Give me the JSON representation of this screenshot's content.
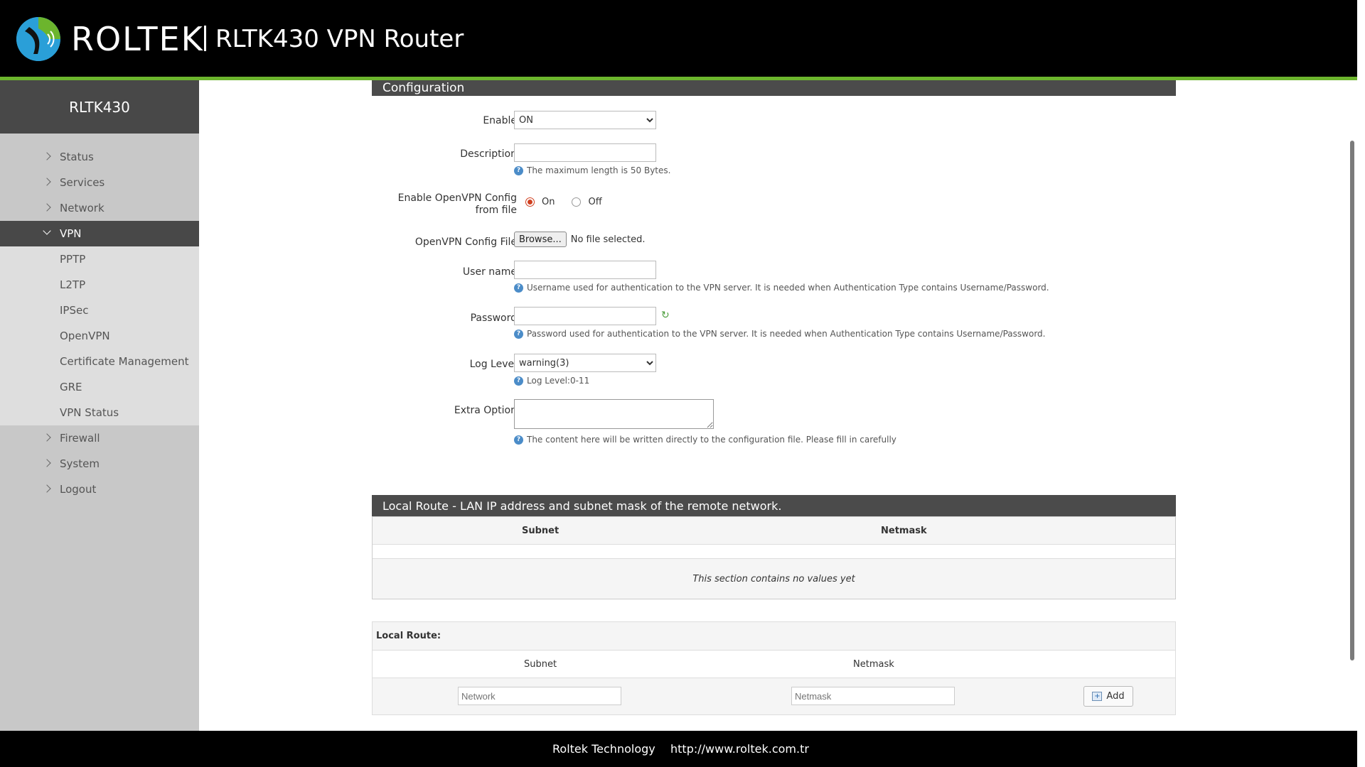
{
  "header": {
    "brand": "ROLTEK",
    "product": "RLTK430 VPN Router"
  },
  "sidebar": {
    "title": "RLTK430",
    "items": [
      {
        "label": "Status"
      },
      {
        "label": "Services"
      },
      {
        "label": "Network"
      },
      {
        "label": "VPN"
      },
      {
        "label": "Firewall"
      },
      {
        "label": "System"
      },
      {
        "label": "Logout"
      }
    ],
    "vpn_sub": [
      {
        "label": "PPTP"
      },
      {
        "label": "L2TP"
      },
      {
        "label": "IPSec"
      },
      {
        "label": "OpenVPN"
      },
      {
        "label": "Certificate Management"
      },
      {
        "label": "GRE"
      },
      {
        "label": "VPN Status"
      }
    ]
  },
  "config": {
    "section_title": "Configuration",
    "enable_label": "Enable",
    "enable_value": "ON",
    "description_label": "Description",
    "description_hint": "The maximum length is 50 Bytes.",
    "ovpn_from_file_label": "Enable OpenVPN Config from file",
    "radio_on": "On",
    "radio_off": "Off",
    "config_file_label": "OpenVPN Config File",
    "browse_label": "Browse...",
    "no_file": "No file selected.",
    "username_label": "User name",
    "username_hint": "Username used for authentication to the VPN server. It is needed when Authentication Type contains Username/Password.",
    "password_label": "Password",
    "password_hint": "Password used for authentication to the VPN server. It is needed when Authentication Type contains Username/Password.",
    "loglevel_label": "Log Level",
    "loglevel_value": "warning(3)",
    "loglevel_hint": "Log Level:0-11",
    "extra_label": "Extra Option",
    "extra_hint": "The content here will be written directly to the configuration file. Please fill in carefully"
  },
  "local_route_table": {
    "title": "Local Route - LAN IP address and subnet mask of the remote network.",
    "col_subnet": "Subnet",
    "col_netmask": "Netmask",
    "empty_text": "This section contains no values yet"
  },
  "local_route_add": {
    "title": "Local Route:",
    "col_subnet": "Subnet",
    "col_netmask": "Netmask",
    "network_placeholder": "Network",
    "netmask_placeholder": "Netmask",
    "add_label": "Add"
  },
  "footer": {
    "company": "Roltek Technology",
    "url": "http://www.roltek.com.tr"
  }
}
